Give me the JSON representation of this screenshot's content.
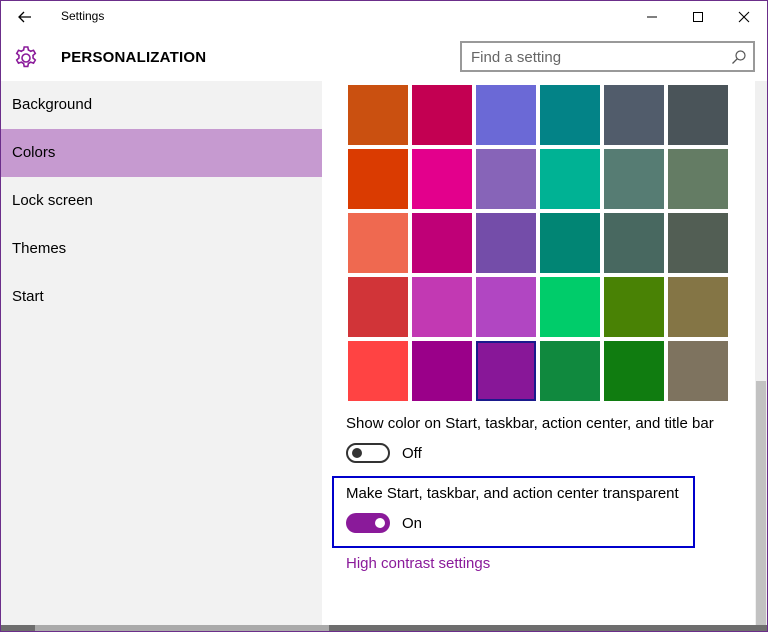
{
  "titlebar": {
    "title": "Settings"
  },
  "header": {
    "section_title": "PERSONALIZATION",
    "search_placeholder": "Find a setting"
  },
  "sidebar": {
    "items": [
      {
        "label": "Background",
        "selected": false
      },
      {
        "label": "Colors",
        "selected": true
      },
      {
        "label": "Lock screen",
        "selected": false
      },
      {
        "label": "Themes",
        "selected": false
      },
      {
        "label": "Start",
        "selected": false
      }
    ]
  },
  "colors": {
    "accent": "#8a1a9a",
    "selected_sidebar_bg": "#c69ad0",
    "swatch_rows": [
      [
        "#ca5010",
        "#c30052",
        "#6b69d6",
        "#038387",
        "#515c6b",
        "#4a5459"
      ],
      [
        "#da3b01",
        "#e3008c",
        "#8764b8",
        "#00b294",
        "#567c73",
        "#647c64"
      ],
      [
        "#ef6950",
        "#bf0077",
        "#744da9",
        "#018574",
        "#486860",
        "#525e54"
      ],
      [
        "#d13438",
        "#c239b3",
        "#b146c2",
        "#00cc6a",
        "#498205",
        "#847545"
      ],
      [
        "#ff4343",
        "#9a0089",
        "#881798",
        "#10893e",
        "#107c10",
        "#7e735f"
      ]
    ],
    "selected_swatch": {
      "row": 4,
      "col": 2
    }
  },
  "settings": {
    "show_color_label": "Show color on Start, taskbar, action center, and title bar",
    "show_color_state": "Off",
    "transparent_label": "Make Start, taskbar, and action center transparent",
    "transparent_state": "On",
    "high_contrast_link": "High contrast settings"
  },
  "icons": {
    "back": "back-arrow-icon",
    "minimize": "minimize-icon",
    "maximize": "maximize-icon",
    "close": "close-icon",
    "gear": "gear-icon",
    "search": "search-icon"
  }
}
